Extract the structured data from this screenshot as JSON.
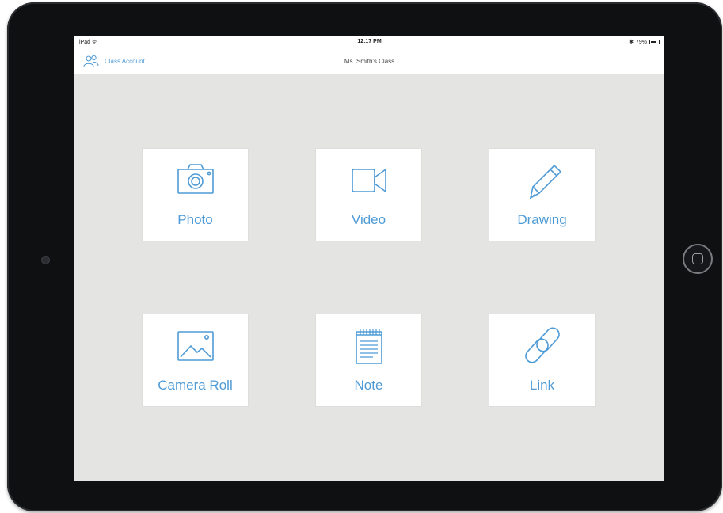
{
  "status_bar": {
    "carrier": "iPad ᯤ",
    "time": "12:17 PM",
    "battery": "79%",
    "battery_level": 0.79
  },
  "nav": {
    "account_label": "Class Account",
    "title": "Ms. Smith's Class"
  },
  "tiles": [
    {
      "label": "Photo",
      "icon": "camera-icon"
    },
    {
      "label": "Video",
      "icon": "video-camera-icon"
    },
    {
      "label": "Drawing",
      "icon": "pencil-icon"
    },
    {
      "label": "Camera Roll",
      "icon": "image-icon"
    },
    {
      "label": "Note",
      "icon": "notepad-icon"
    },
    {
      "label": "Link",
      "icon": "chain-link-icon"
    }
  ],
  "colors": {
    "accent": "#4f9bd6",
    "screen_background": "#e4e4e2",
    "bezel": "#0f1012"
  }
}
